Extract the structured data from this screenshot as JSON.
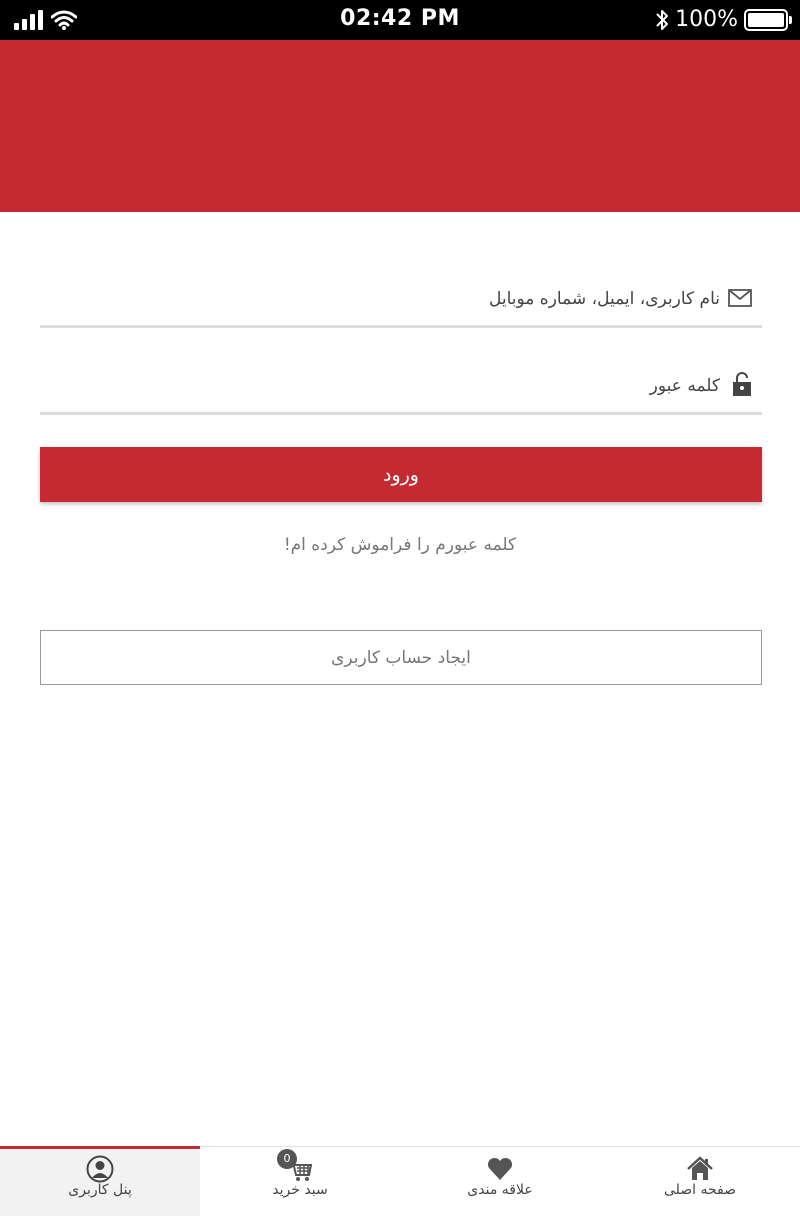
{
  "colors": {
    "brand": "#c52a33",
    "status_bar": "#000000",
    "input_underline": "#dddddd",
    "icon": "#555555"
  },
  "status_bar": {
    "time": "02:42 PM",
    "battery": "100%",
    "battery_level": 1.0,
    "signal_bars": 4,
    "icons": [
      "signal-icon",
      "wifi-icon",
      "bluetooth-icon",
      "battery-icon"
    ]
  },
  "login_form": {
    "username_label": "نام کاربری، ایمیل، شماره موبایل",
    "username_icon": "envelope-icon",
    "password_label": "کلمه عبور",
    "password_icon": "lock-icon",
    "login_button": "ورود",
    "forgot_password": "کلمه عبورم را فراموش کرده ام!",
    "register_button": "ایجاد حساب کاربری"
  },
  "bottom_nav": {
    "items": [
      {
        "label": "پنل کاربری",
        "icon": "user-icon",
        "active": true
      },
      {
        "label": "سبد خرید",
        "icon": "cart-icon",
        "badge": "0",
        "active": false
      },
      {
        "label": "علاقه مندی",
        "icon": "heart-icon",
        "active": false
      },
      {
        "label": "صفحه اصلی",
        "icon": "home-icon",
        "active": false
      }
    ]
  }
}
